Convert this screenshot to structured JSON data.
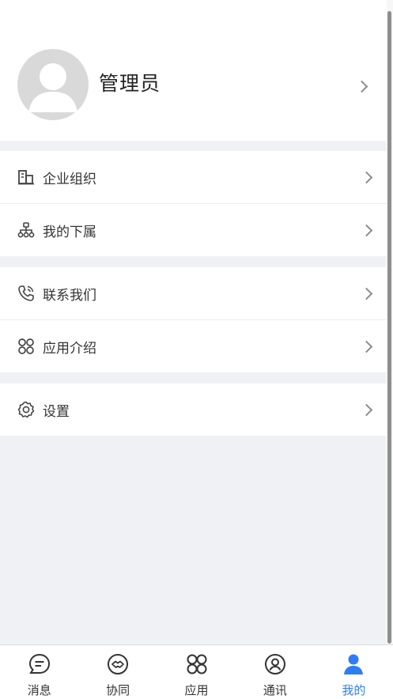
{
  "profile": {
    "name": "管理员"
  },
  "menu": {
    "group1": [
      {
        "label": "企业组织",
        "icon": "building-icon"
      },
      {
        "label": "我的下属",
        "icon": "org-chart-icon"
      }
    ],
    "group2": [
      {
        "label": "联系我们",
        "icon": "phone-icon"
      },
      {
        "label": "应用介绍",
        "icon": "apps-icon"
      }
    ],
    "group3": [
      {
        "label": "设置",
        "icon": "gear-icon"
      }
    ]
  },
  "tabbar": {
    "tabs": [
      {
        "label": "消息",
        "icon": "message-icon"
      },
      {
        "label": "协同",
        "icon": "handshake-icon"
      },
      {
        "label": "应用",
        "icon": "apps-icon"
      },
      {
        "label": "通讯",
        "icon": "contacts-icon"
      },
      {
        "label": "我的",
        "icon": "person-icon",
        "active": true
      }
    ],
    "active_color": "#2f7df6"
  }
}
